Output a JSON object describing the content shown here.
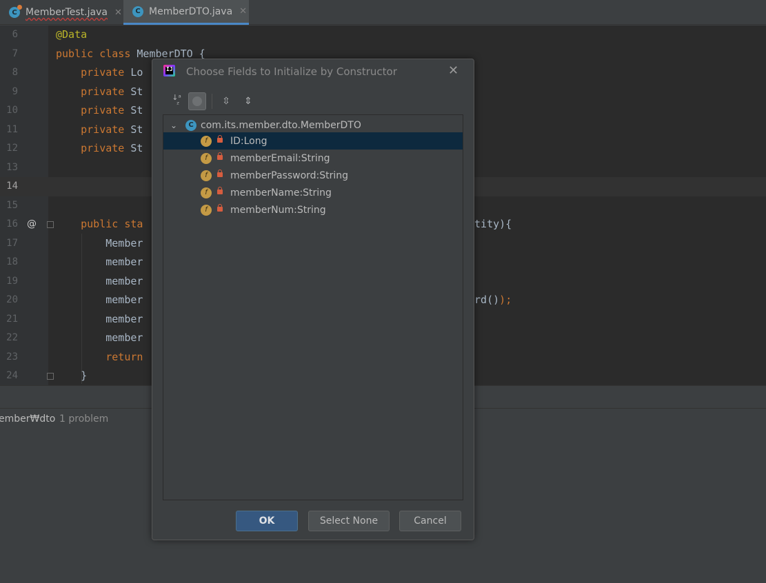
{
  "tabs": [
    {
      "label": "MemberTest.java",
      "icon": "java-class-icon"
    },
    {
      "label": "MemberDTO.java",
      "icon": "java-class-icon",
      "active": true
    }
  ],
  "editor": {
    "lines": [
      {
        "num": "6",
        "code": "@Data"
      },
      {
        "num": "7",
        "code": "public class MemberDTO {"
      },
      {
        "num": "8",
        "code": "    private Lo"
      },
      {
        "num": "9",
        "code": "    private St"
      },
      {
        "num": "10",
        "code": "    private St"
      },
      {
        "num": "11",
        "code": "    private St"
      },
      {
        "num": "12",
        "code": "    private St"
      },
      {
        "num": "13",
        "code": ""
      },
      {
        "num": "14",
        "code": ""
      },
      {
        "num": "15",
        "code": ""
      },
      {
        "num": "16",
        "code": "    public sta",
        "tail": "ntity){"
      },
      {
        "num": "17",
        "code": "        Member"
      },
      {
        "num": "18",
        "code": "        member"
      },
      {
        "num": "19",
        "code": "        member"
      },
      {
        "num": "20",
        "code": "        member",
        "tail": "ord());"
      },
      {
        "num": "21",
        "code": "        member"
      },
      {
        "num": "22",
        "code": "        member"
      },
      {
        "num": "23",
        "code": "        return"
      },
      {
        "num": "24",
        "code": "    }"
      }
    ],
    "gutter_marker_16": "@"
  },
  "problems": {
    "path": "ember₩dto",
    "count": "1 problem"
  },
  "dialog": {
    "title": "Choose Fields to Initialize by Constructor",
    "logo_text": "IJ",
    "root": "com.its.member.dto.MemberDTO",
    "fields": [
      {
        "label": "ID:Long",
        "selected": true
      },
      {
        "label": "memberEmail:String",
        "selected": false
      },
      {
        "label": "memberPassword:String",
        "selected": false
      },
      {
        "label": "memberName:String",
        "selected": false
      },
      {
        "label": "memberNum:String",
        "selected": false
      }
    ],
    "buttons": {
      "ok": "OK",
      "select_none": "Select None",
      "cancel": "Cancel"
    }
  },
  "colors": {
    "editor_bg": "#2b2b2b",
    "keyword": "#cc7832",
    "annotation": "#bbb529",
    "selection": "#0d293e",
    "ok_button": "#365880"
  }
}
